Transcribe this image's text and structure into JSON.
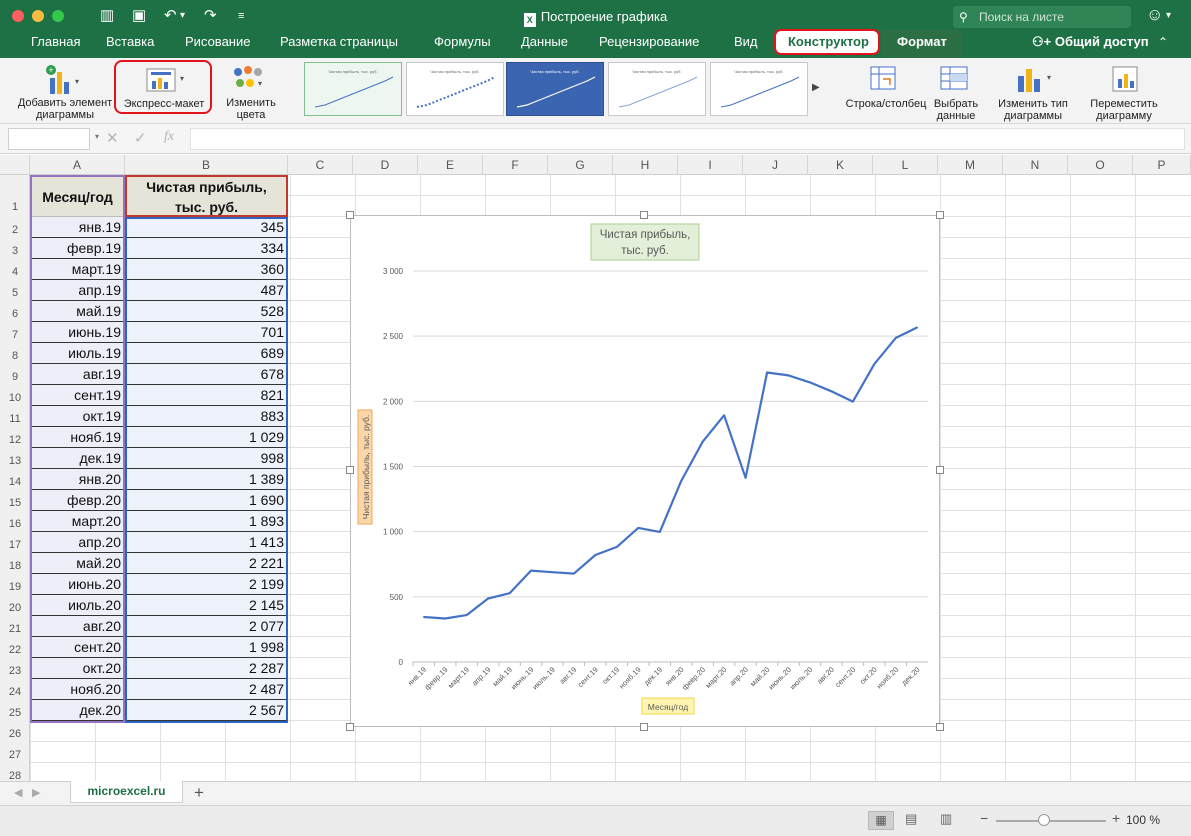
{
  "window": {
    "title": "Построение графика",
    "search_placeholder": "Поиск на листе"
  },
  "ribbon_tabs": [
    "Главная",
    "Вставка",
    "Рисование",
    "Разметка страницы",
    "Формулы",
    "Данные",
    "Рецензирование",
    "Вид",
    "Конструктор",
    "Формат"
  ],
  "active_tab": "Конструктор",
  "share_label": "Общий доступ",
  "ribbon": {
    "add_element": "Добавить элемент\nдиаграммы",
    "express_layout": "Экспресс-макет",
    "change_colors": "Изменить\nцвета",
    "row_col": "Строка/столбец",
    "select_data": "Выбрать\nданные",
    "change_type": "Изменить тип\nдиаграммы",
    "move_chart": "Переместить\nдиаграмму"
  },
  "thumb_titles": [
    "Чистая прибыль,\nтыс. руб.",
    "Чистая прибыль,\nтыс. руб.",
    "Чистая прибыль,\nтыс. руб.",
    "Чистая прибыль,\nтыс. руб.",
    "Чистая прибыль,\nтыс. руб."
  ],
  "formula_bar": {
    "fx": "fx"
  },
  "columns": [
    "A",
    "B",
    "C",
    "D",
    "E",
    "F",
    "G",
    "H",
    "I",
    "J",
    "K",
    "L",
    "M",
    "N",
    "O",
    "P"
  ],
  "row_numbers": [
    1,
    2,
    3,
    4,
    5,
    6,
    7,
    8,
    9,
    10,
    11,
    12,
    13,
    14,
    15,
    16,
    17,
    18,
    19,
    20,
    21,
    22,
    23,
    24,
    25,
    26,
    27,
    28
  ],
  "table": {
    "header_month": "Месяц/год",
    "header_profit": "Чистая прибыль,\nтыс. руб.",
    "months": [
      "янв.19",
      "февр.19",
      "март.19",
      "апр.19",
      "май.19",
      "июнь.19",
      "июль.19",
      "авг.19",
      "сент.19",
      "окт.19",
      "нояб.19",
      "дек.19",
      "янв.20",
      "февр.20",
      "март.20",
      "апр.20",
      "май.20",
      "июнь.20",
      "июль.20",
      "авг.20",
      "сент.20",
      "окт.20",
      "нояб.20",
      "дек.20"
    ],
    "profit_text": [
      "345",
      "334",
      "360",
      "487",
      "528",
      "701",
      "689",
      "678",
      "821",
      "883",
      "1 029",
      "998",
      "1 389",
      "1 690",
      "1 893",
      "1 413",
      "2 221",
      "2 199",
      "2 145",
      "2 077",
      "1 998",
      "2 287",
      "2 487",
      "2 567"
    ]
  },
  "chart_data": {
    "type": "line",
    "title": "Чистая прибыль,\nтыс. руб.",
    "xlabel": "Месяц/год",
    "ylabel": "Чистая прибыль, тыс. руб.",
    "categories": [
      "янв.19",
      "февр.19",
      "март.19",
      "апр.19",
      "май.19",
      "июнь.19",
      "июль.19",
      "авг.19",
      "сент.19",
      "окт.19",
      "нояб.19",
      "дек.19",
      "янв.20",
      "февр.20",
      "март.20",
      "апр.20",
      "май.20",
      "июнь.20",
      "июль.20",
      "авг.20",
      "сент.20",
      "окт.20",
      "нояб.20",
      "дек.20"
    ],
    "values": [
      345,
      334,
      360,
      487,
      528,
      701,
      689,
      678,
      821,
      883,
      1029,
      998,
      1389,
      1690,
      1893,
      1413,
      2221,
      2199,
      2145,
      2077,
      1998,
      2287,
      2487,
      2567
    ],
    "ylim": [
      0,
      3000
    ],
    "yticks": [
      0,
      500,
      1000,
      1500,
      2000,
      2500,
      3000
    ],
    "ytick_labels": [
      "0",
      "500",
      "1 000",
      "1 500",
      "2 000",
      "2 500",
      "3 000"
    ],
    "grid": true,
    "line_color": "#4472c4"
  },
  "sheet_tab": "microexcel.ru",
  "zoom": "100 %",
  "colors": {
    "excel_green": "#1e7145",
    "highlight_red": "#e0141a",
    "series": "#4472c4"
  }
}
